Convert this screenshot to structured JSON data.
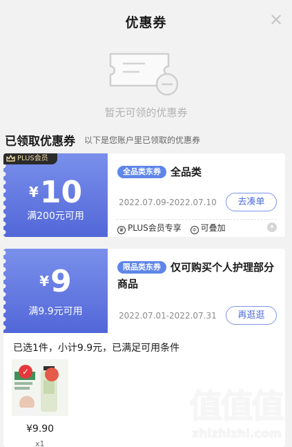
{
  "header": {
    "title": "优惠券",
    "close_icon": "close-icon"
  },
  "empty_state": {
    "text": "暂无可领的优惠券",
    "icon": "empty-coupon-icon"
  },
  "claimed": {
    "title": "已领取优惠券",
    "subtitle": "以下是您账户里已领取的优惠券"
  },
  "coupons": [
    {
      "badge": "PLUS会员",
      "currency": "¥",
      "amount": "10",
      "condition": "满200元可用",
      "tag": "全品类东券",
      "title": "全品类",
      "date": "2022.07.09-2022.07.10",
      "button": "去凑单",
      "features": [
        "PLUS会员专享",
        "可叠加"
      ]
    },
    {
      "currency": "¥",
      "amount": "9",
      "condition": "满9.9元可用",
      "tag": "限品类东券",
      "title": "仅可购买个人护理部分商品",
      "date": "2022.07.01-2022.07.31",
      "button": "再逛逛"
    }
  ],
  "selection": {
    "summary": "已选1件，小计9.9元，已满足可用条件",
    "price": "¥9.90",
    "quantity": "x1"
  },
  "watermark": {
    "logo": "值值值",
    "text": "zhizhizhi.com"
  },
  "colors": {
    "coupon_blue": "#5f86e8",
    "accent_red": "#e4393c"
  }
}
